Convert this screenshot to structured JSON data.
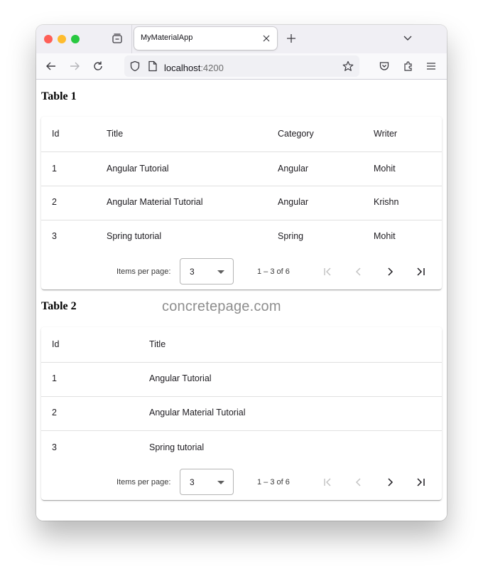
{
  "browser": {
    "tab_title": "MyMaterialApp",
    "url_host": "localhost",
    "url_port": ":4200"
  },
  "watermark": "concretepage.com",
  "table1": {
    "heading": "Table 1",
    "columns": [
      "Id",
      "Title",
      "Category",
      "Writer"
    ],
    "rows": [
      [
        "1",
        "Angular Tutorial",
        "Angular",
        "Mohit"
      ],
      [
        "2",
        "Angular Material Tutorial",
        "Angular",
        "Krishn"
      ],
      [
        "3",
        "Spring tutorial",
        "Spring",
        "Mohit"
      ]
    ],
    "paginator": {
      "items_per_page_label": "Items per page:",
      "page_size": "3",
      "range_label": "1 – 3 of 6"
    }
  },
  "table2": {
    "heading": "Table 2",
    "columns": [
      "Id",
      "Title"
    ],
    "rows": [
      [
        "1",
        "Angular Tutorial"
      ],
      [
        "2",
        "Angular Material Tutorial"
      ],
      [
        "3",
        "Spring tutorial"
      ]
    ],
    "paginator": {
      "items_per_page_label": "Items per page:",
      "page_size": "3",
      "range_label": "1 – 3 of 6"
    }
  },
  "colors": {
    "close_red": "#fe5f57",
    "minimize_yellow": "#febc2e",
    "zoom_green": "#28c840",
    "divider": "#e0e0e0"
  }
}
